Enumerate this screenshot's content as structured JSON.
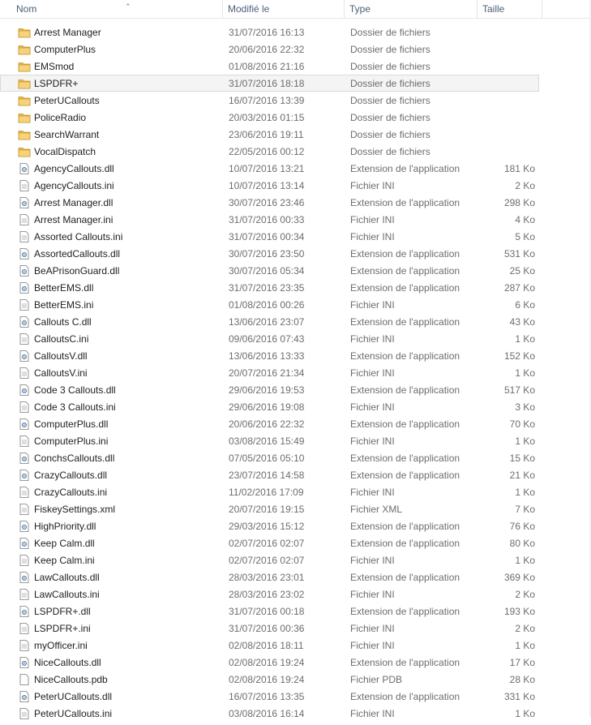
{
  "columns": {
    "name": "Nom",
    "date": "Modifié le",
    "type": "Type",
    "size": "Taille"
  },
  "colors": {
    "folder": "#e8b64a",
    "selected_row": "#f4f4f4",
    "header_text": "#4c607a"
  },
  "files": [
    {
      "name": "Arrest Manager",
      "date": "31/07/2016 16:13",
      "type": "Dossier de fichiers",
      "size": "",
      "icon": "folder-icon"
    },
    {
      "name": "ComputerPlus",
      "date": "20/06/2016 22:32",
      "type": "Dossier de fichiers",
      "size": "",
      "icon": "folder-icon"
    },
    {
      "name": "EMSmod",
      "date": "01/08/2016 21:16",
      "type": "Dossier de fichiers",
      "size": "",
      "icon": "folder-icon"
    },
    {
      "name": "LSPDFR+",
      "date": "31/07/2016 18:18",
      "type": "Dossier de fichiers",
      "size": "",
      "icon": "folder-icon",
      "selected": true
    },
    {
      "name": "PeterUCallouts",
      "date": "16/07/2016 13:39",
      "type": "Dossier de fichiers",
      "size": "",
      "icon": "folder-icon"
    },
    {
      "name": "PoliceRadio",
      "date": "20/03/2016 01:15",
      "type": "Dossier de fichiers",
      "size": "",
      "icon": "folder-icon"
    },
    {
      "name": "SearchWarrant",
      "date": "23/06/2016 19:11",
      "type": "Dossier de fichiers",
      "size": "",
      "icon": "folder-icon"
    },
    {
      "name": "VocalDispatch",
      "date": "22/05/2016 00:12",
      "type": "Dossier de fichiers",
      "size": "",
      "icon": "folder-icon"
    },
    {
      "name": "AgencyCallouts.dll",
      "date": "10/07/2016 13:21",
      "type": "Extension de l'application",
      "size": "181 Ko",
      "icon": "dll-file-icon"
    },
    {
      "name": "AgencyCallouts.ini",
      "date": "10/07/2016 13:14",
      "type": "Fichier INI",
      "size": "2 Ko",
      "icon": "text-file-icon"
    },
    {
      "name": "Arrest Manager.dll",
      "date": "30/07/2016 23:46",
      "type": "Extension de l'application",
      "size": "298 Ko",
      "icon": "dll-file-icon"
    },
    {
      "name": "Arrest Manager.ini",
      "date": "31/07/2016 00:33",
      "type": "Fichier INI",
      "size": "4 Ko",
      "icon": "text-file-icon"
    },
    {
      "name": "Assorted Callouts.ini",
      "date": "31/07/2016 00:34",
      "type": "Fichier INI",
      "size": "5 Ko",
      "icon": "text-file-icon"
    },
    {
      "name": "AssortedCallouts.dll",
      "date": "30/07/2016 23:50",
      "type": "Extension de l'application",
      "size": "531 Ko",
      "icon": "dll-file-icon"
    },
    {
      "name": "BeAPrisonGuard.dll",
      "date": "30/07/2016 05:34",
      "type": "Extension de l'application",
      "size": "25 Ko",
      "icon": "dll-file-icon"
    },
    {
      "name": "BetterEMS.dll",
      "date": "31/07/2016 23:35",
      "type": "Extension de l'application",
      "size": "287 Ko",
      "icon": "dll-file-icon"
    },
    {
      "name": "BetterEMS.ini",
      "date": "01/08/2016 00:26",
      "type": "Fichier INI",
      "size": "6 Ko",
      "icon": "text-file-icon"
    },
    {
      "name": "Callouts C.dll",
      "date": "13/06/2016 23:07",
      "type": "Extension de l'application",
      "size": "43 Ko",
      "icon": "dll-file-icon"
    },
    {
      "name": "CalloutsC.ini",
      "date": "09/06/2016 07:43",
      "type": "Fichier INI",
      "size": "1 Ko",
      "icon": "text-file-icon"
    },
    {
      "name": "CalloutsV.dll",
      "date": "13/06/2016 13:33",
      "type": "Extension de l'application",
      "size": "152 Ko",
      "icon": "dll-file-icon"
    },
    {
      "name": "CalloutsV.ini",
      "date": "20/07/2016 21:34",
      "type": "Fichier INI",
      "size": "1 Ko",
      "icon": "text-file-icon"
    },
    {
      "name": "Code 3 Callouts.dll",
      "date": "29/06/2016 19:53",
      "type": "Extension de l'application",
      "size": "517 Ko",
      "icon": "dll-file-icon"
    },
    {
      "name": "Code 3 Callouts.ini",
      "date": "29/06/2016 19:08",
      "type": "Fichier INI",
      "size": "3 Ko",
      "icon": "text-file-icon"
    },
    {
      "name": "ComputerPlus.dll",
      "date": "20/06/2016 22:32",
      "type": "Extension de l'application",
      "size": "70 Ko",
      "icon": "dll-file-icon"
    },
    {
      "name": "ComputerPlus.ini",
      "date": "03/08/2016 15:49",
      "type": "Fichier INI",
      "size": "1 Ko",
      "icon": "text-file-icon"
    },
    {
      "name": "ConchsCallouts.dll",
      "date": "07/05/2016 05:10",
      "type": "Extension de l'application",
      "size": "15 Ko",
      "icon": "dll-file-icon"
    },
    {
      "name": "CrazyCallouts.dll",
      "date": "23/07/2016 14:58",
      "type": "Extension de l'application",
      "size": "21 Ko",
      "icon": "dll-file-icon"
    },
    {
      "name": "CrazyCallouts.ini",
      "date": "11/02/2016 17:09",
      "type": "Fichier INI",
      "size": "1 Ko",
      "icon": "text-file-icon"
    },
    {
      "name": "FiskeySettings.xml",
      "date": "20/07/2016 19:15",
      "type": "Fichier XML",
      "size": "7 Ko",
      "icon": "text-file-icon"
    },
    {
      "name": "HighPriority.dll",
      "date": "29/03/2016 15:12",
      "type": "Extension de l'application",
      "size": "76 Ko",
      "icon": "dll-file-icon"
    },
    {
      "name": "Keep Calm.dll",
      "date": "02/07/2016 02:07",
      "type": "Extension de l'application",
      "size": "80 Ko",
      "icon": "dll-file-icon"
    },
    {
      "name": "Keep Calm.ini",
      "date": "02/07/2016 02:07",
      "type": "Fichier INI",
      "size": "1 Ko",
      "icon": "text-file-icon"
    },
    {
      "name": "LawCallouts.dll",
      "date": "28/03/2016 23:01",
      "type": "Extension de l'application",
      "size": "369 Ko",
      "icon": "dll-file-icon"
    },
    {
      "name": "LawCallouts.ini",
      "date": "28/03/2016 23:02",
      "type": "Fichier INI",
      "size": "2 Ko",
      "icon": "text-file-icon"
    },
    {
      "name": "LSPDFR+.dll",
      "date": "31/07/2016 00:18",
      "type": "Extension de l'application",
      "size": "193 Ko",
      "icon": "dll-file-icon"
    },
    {
      "name": "LSPDFR+.ini",
      "date": "31/07/2016 00:36",
      "type": "Fichier INI",
      "size": "2 Ko",
      "icon": "text-file-icon"
    },
    {
      "name": "myOfficer.ini",
      "date": "02/08/2016 18:11",
      "type": "Fichier INI",
      "size": "1 Ko",
      "icon": "text-file-icon"
    },
    {
      "name": "NiceCallouts.dll",
      "date": "02/08/2016 19:24",
      "type": "Extension de l'application",
      "size": "17 Ko",
      "icon": "dll-file-icon"
    },
    {
      "name": "NiceCallouts.pdb",
      "date": "02/08/2016 19:24",
      "type": "Fichier PDB",
      "size": "28 Ko",
      "icon": "blank-file-icon"
    },
    {
      "name": "PeterUCallouts.dll",
      "date": "16/07/2016 13:35",
      "type": "Extension de l'application",
      "size": "331 Ko",
      "icon": "dll-file-icon"
    },
    {
      "name": "PeterUCallouts.ini",
      "date": "03/08/2016 16:14",
      "type": "Fichier INI",
      "size": "1 Ko",
      "icon": "text-file-icon"
    }
  ]
}
